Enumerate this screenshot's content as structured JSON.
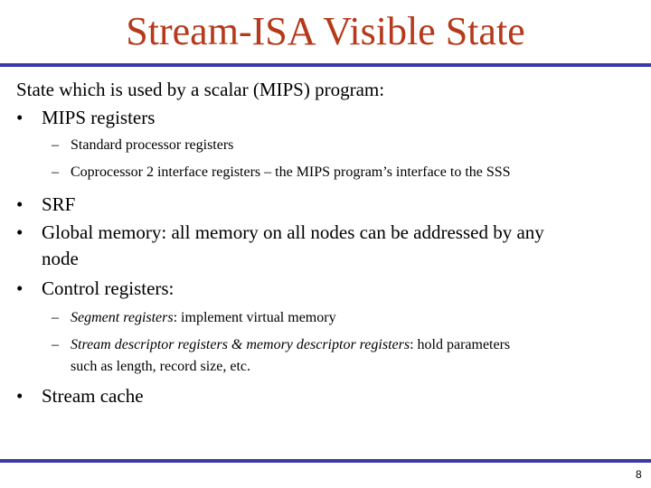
{
  "slide": {
    "title": "Stream-ISA Visible State",
    "page_number": "8",
    "colors": {
      "title": "#B5391A",
      "rule": "#3A3AAD"
    },
    "intro": "State which is used by a scalar (MIPS) program:",
    "bullet_glyph": "•",
    "dash_glyph": "–",
    "items": [
      {
        "text": "MIPS registers",
        "subitems": [
          {
            "text": "Standard processor registers"
          },
          {
            "text": "Coprocessor 2 interface registers – the MIPS program’s interface to the SSS"
          }
        ]
      },
      {
        "text": "SRF"
      },
      {
        "text_line1": "Global memory: all memory on all nodes can be addressed by any",
        "text_line2": "node"
      },
      {
        "text": "Control registers:",
        "subitems": [
          {
            "term": "Segment registers",
            "rest": ": implement virtual memory"
          },
          {
            "term": "Stream descriptor registers & memory descriptor registers",
            "rest": ": hold parameters",
            "continuation": "such as length, record size, etc."
          }
        ]
      },
      {
        "text": "Stream cache"
      }
    ]
  }
}
